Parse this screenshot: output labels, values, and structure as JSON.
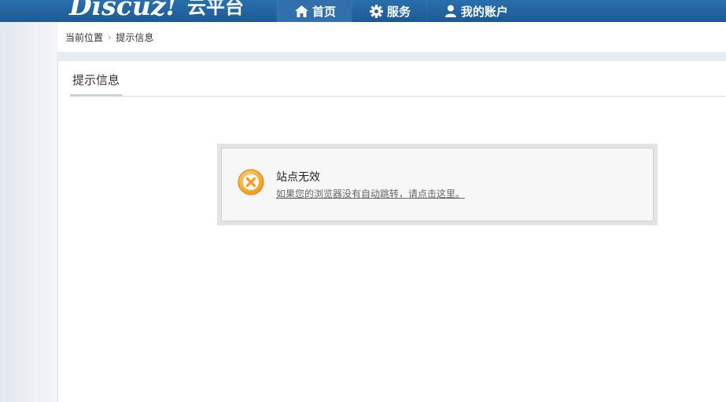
{
  "header": {
    "logo": "Discuz!",
    "logo_sub": "云平台",
    "nav": [
      {
        "label": "首页",
        "icon": "home-icon",
        "active": true
      },
      {
        "label": "服务",
        "icon": "gear-icon",
        "active": false
      },
      {
        "label": "我的账户",
        "icon": "user-icon",
        "active": false
      }
    ]
  },
  "breadcrumb": {
    "prefix": "当前位置",
    "separator": "›",
    "current": "提示信息"
  },
  "main": {
    "tab_label": "提示信息",
    "message": {
      "title": "站点无效",
      "link": "如果您的浏览器没有自动跳转，请点击这里。",
      "icon": "error-x-icon"
    }
  },
  "colors": {
    "header_bg": "#1d5a94",
    "nav_active_bg": "#336faa",
    "error_icon_orange": "#f5a623"
  }
}
